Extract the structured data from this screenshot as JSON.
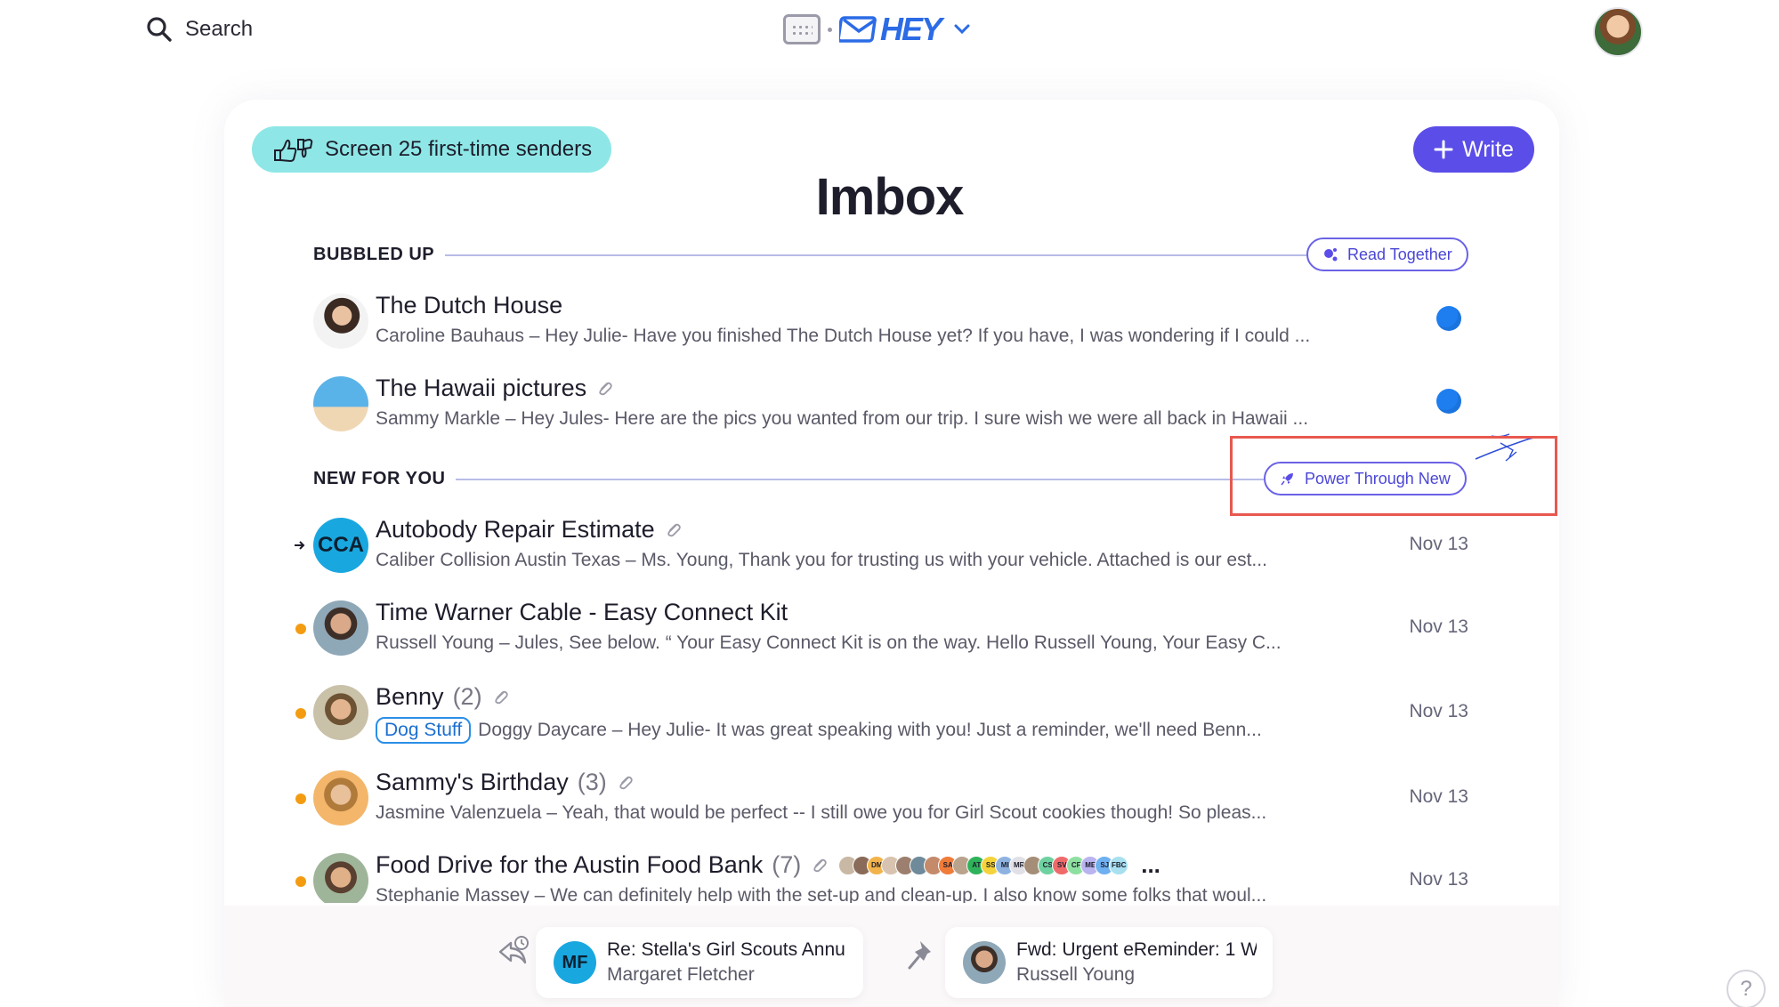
{
  "topbar": {
    "search_label": "Search",
    "logo_text": "HEY",
    "icons": [
      "search-icon",
      "calendar-icon",
      "envelope-icon",
      "chevron-down-icon"
    ]
  },
  "screen_button": {
    "label": "Screen 25 first-time senders",
    "color": "#8ee7e6"
  },
  "write_button": {
    "label": "Write",
    "color": "#5b4de8"
  },
  "page_title": "Imbox",
  "bubbled_up": {
    "heading": "BUBBLED UP",
    "action_label": "Read Together",
    "items": [
      {
        "subject": "The Dutch House",
        "preview": "Caroline Bauhaus – Hey Julie- Have you finished The Dutch House yet? If you have, I was wondering if I could ...",
        "attachment": false
      },
      {
        "subject": "The Hawaii pictures",
        "preview": "Sammy Markle – Hey Jules- Here are the pics you wanted from our trip. I sure wish we were all back in Hawaii ...",
        "attachment": true
      }
    ]
  },
  "new_for_you": {
    "heading": "NEW FOR YOU",
    "action_label": "Power Through New",
    "items": [
      {
        "subject": "Autobody Repair Estimate",
        "count": "",
        "tag": "",
        "preview": "Caliber Collision Austin Texas – Ms. Young, Thank you for trusting us with your vehicle. Attached is our est...",
        "date": "Nov 13",
        "avatar_initials": "CCA"
      },
      {
        "subject": "Time Warner Cable - Easy Connect Kit",
        "count": "",
        "tag": "",
        "preview": "Russell Young – Jules, See below. “ Your Easy Connect Kit is on the way. Hello Russell Young, Your Easy C...",
        "date": "Nov 13"
      },
      {
        "subject": "Benny",
        "count": "(2)",
        "tag": "Dog Stuff",
        "preview": "Doggy Daycare – Hey Julie- It was great speaking with you! Just a reminder, we'll need Benn...",
        "date": "Nov 13"
      },
      {
        "subject": "Sammy's Birthday",
        "count": "(3)",
        "tag": "",
        "preview": "Jasmine Valenzuela – Yeah, that would be perfect -- I still owe you for Girl Scout cookies though! So pleas...",
        "date": "Nov 13"
      },
      {
        "subject": "Food Drive for the Austin Food Bank",
        "count": "(7)",
        "tag": "",
        "preview": "Stephanie Massey – We can definitely help with the set-up and clean-up. I also know some folks that woul...",
        "date": "Nov 13",
        "participants": [
          "",
          "",
          "DM",
          "",
          "",
          "",
          "",
          "SA",
          "",
          "AT",
          "SS",
          "MI",
          "MR",
          "",
          "CS",
          "SV",
          "CF",
          "ME",
          "SJ",
          "FBC"
        ],
        "more": "..."
      }
    ]
  },
  "bottom": {
    "reply_later": {
      "subject": "Re: Stella's Girl Scouts Annu",
      "sender": "Margaret Fletcher",
      "initials": "MF"
    },
    "set_aside": {
      "subject": "Fwd: Urgent eReminder: 1 W",
      "sender": "Russell Young"
    }
  },
  "help_label": "?",
  "colors": {
    "accent": "#5b4de8",
    "unread": "#1e7ef0",
    "new_dot": "#f39c12",
    "highlight": "#e8584f"
  }
}
